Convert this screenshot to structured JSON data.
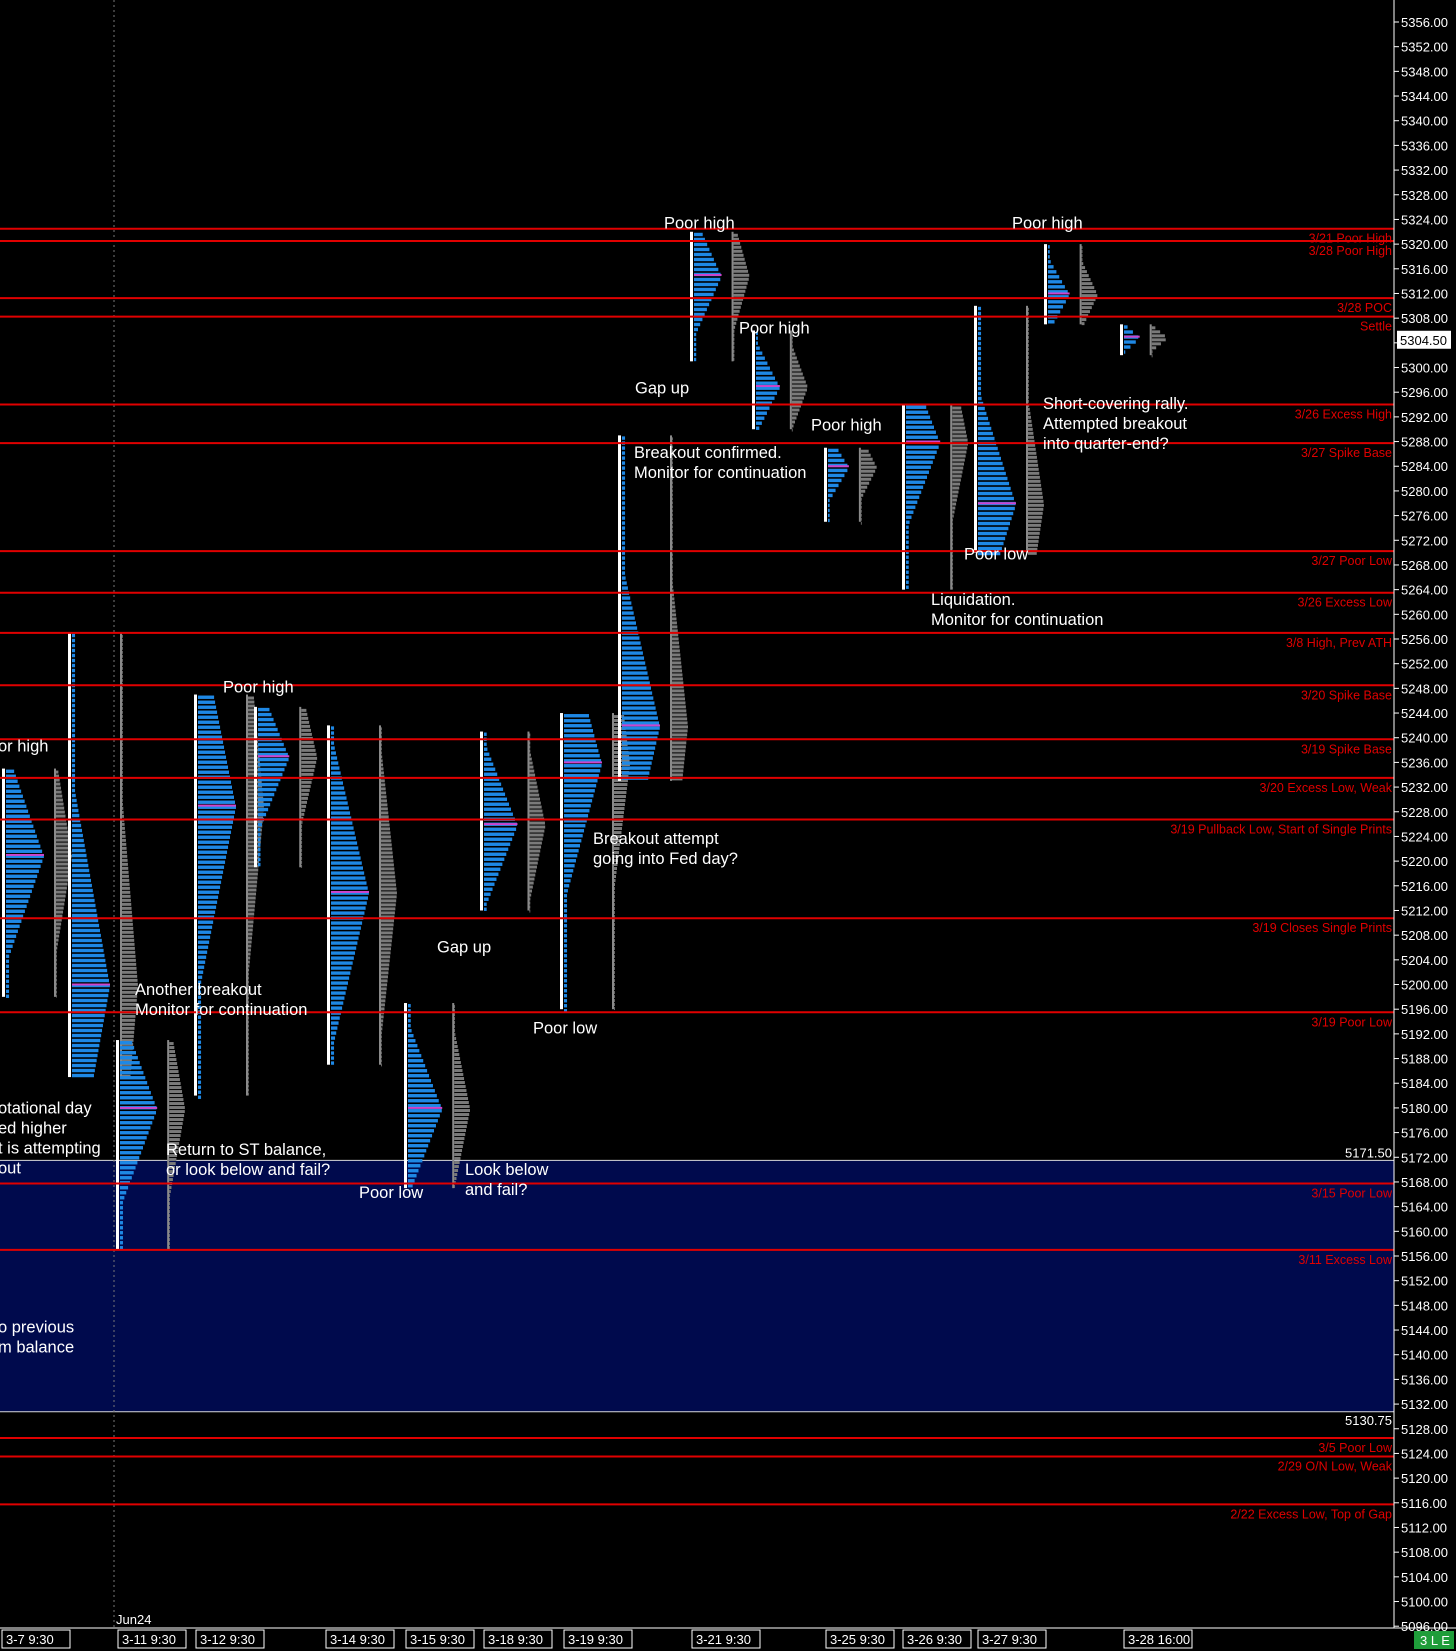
{
  "chart_data": {
    "type": "market-profile",
    "contract_label": "Jun24",
    "last_price": "5304.50",
    "status_badge": "3 L E",
    "y_range": [
      5096,
      5356
    ],
    "y_ticks": [
      "5356.00",
      "5352.00",
      "5348.00",
      "5344.00",
      "5340.00",
      "5336.00",
      "5332.00",
      "5328.00",
      "5324.00",
      "5320.00",
      "5316.00",
      "5312.00",
      "5308.00",
      "5304.00",
      "5300.00",
      "5296.00",
      "5292.00",
      "5288.00",
      "5284.00",
      "5280.00",
      "5276.00",
      "5272.00",
      "5268.00",
      "5264.00",
      "5260.00",
      "5256.00",
      "5252.00",
      "5248.00",
      "5244.00",
      "5240.00",
      "5236.00",
      "5232.00",
      "5228.00",
      "5224.00",
      "5220.00",
      "5216.00",
      "5212.00",
      "5208.00",
      "5204.00",
      "5200.00",
      "5196.00",
      "5192.00",
      "5188.00",
      "5184.00",
      "5180.00",
      "5176.00",
      "5172.00",
      "5168.00",
      "5164.00",
      "5160.00",
      "5156.00",
      "5152.00",
      "5148.00",
      "5144.00",
      "5140.00",
      "5136.00",
      "5132.00",
      "5128.00",
      "5124.00",
      "5120.00",
      "5116.00",
      "5112.00",
      "5108.00",
      "5104.00",
      "5100.00",
      "5096.00"
    ],
    "x_ticks": [
      "3-7  9:30",
      "3-11  9:30",
      "3-12  9:30",
      "3-14  9:30",
      "3-15  9:30",
      "3-18  9:30",
      "3-19  9:30",
      "3-21  9:30",
      "3-25  9:30",
      "3-26  9:30",
      "3-27  9:30",
      "3-28  16:00"
    ],
    "balance_zones": [
      {
        "high": 5171.5,
        "low": 5130.75,
        "high_label": "5171.50",
        "low_label": "5130.75"
      }
    ],
    "levels": [
      {
        "price": 5322.5,
        "label": "3/21 Poor High"
      },
      {
        "price": 5320.5,
        "label": "3/28 Poor High"
      },
      {
        "price": 5311.25,
        "label": "3/28 POC"
      },
      {
        "price": 5308.25,
        "label": "Settle"
      },
      {
        "price": 5294.0,
        "label": "3/26 Excess High"
      },
      {
        "price": 5287.75,
        "label": "3/27 Spike Base"
      },
      {
        "price": 5270.25,
        "label": "3/27 Poor Low"
      },
      {
        "price": 5263.5,
        "label": "3/26 Excess Low"
      },
      {
        "price": 5257.0,
        "label": "3/8 High, Prev ATH"
      },
      {
        "price": 5248.5,
        "label": "3/20 Spike Base"
      },
      {
        "price": 5239.75,
        "label": "3/19 Spike Base"
      },
      {
        "price": 5233.5,
        "label": "3/20 Excess Low, Weak"
      },
      {
        "price": 5226.75,
        "label": "3/19 Pullback Low, Start of Single Prints"
      },
      {
        "price": 5210.75,
        "label": "3/19 Closes Single Prints"
      },
      {
        "price": 5195.5,
        "label": "3/19 Poor Low"
      },
      {
        "price": 5167.75,
        "label": "3/15 Poor Low"
      },
      {
        "price": 5157.0,
        "label": "3/11 Excess Low"
      },
      {
        "price": 5126.5,
        "label": "3/5 Poor Low"
      },
      {
        "price": 5123.5,
        "label": "2/29 O/N Low, Weak"
      },
      {
        "price": 5115.75,
        "label": "2/22 Excess Low, Top of Gap"
      }
    ],
    "annotations": [
      {
        "lines": [
          "Poor high"
        ],
        "price": 5322.5
      },
      {
        "lines": [
          "Poor high"
        ],
        "price": 5322.5
      },
      {
        "lines": [
          "Poor high"
        ],
        "price": 5305.5
      },
      {
        "lines": [
          "Gap up"
        ],
        "price": 5295.8
      },
      {
        "lines": [
          "Poor high"
        ],
        "price": 5289.8
      },
      {
        "lines": [
          "Short-covering rally.",
          "Attempted breakout",
          "into quarter-end?"
        ],
        "price": 5293.3
      },
      {
        "lines": [
          "Breakout confirmed.",
          "Monitor for continuation"
        ],
        "price": 5285.3
      },
      {
        "lines": [
          "Poor low"
        ],
        "price": 5268.9
      },
      {
        "lines": [
          "Liquidation.",
          "Monitor for continuation"
        ],
        "price": 5261.5
      },
      {
        "lines": [
          "Poor high"
        ],
        "price": 5247.3
      },
      {
        "lines": [
          "or high"
        ],
        "price": 5237.8
      },
      {
        "lines": [
          "Breakout attempt",
          "going into Fed day?"
        ],
        "price": 5222.8
      },
      {
        "lines": [
          "Gap up"
        ],
        "price": 5205.2
      },
      {
        "lines": [
          "Another breakout",
          "Monitor for continuation"
        ],
        "price": 5198.3
      },
      {
        "lines": [
          "Poor low"
        ],
        "price": 5192.1
      },
      {
        "lines": [
          "otational day",
          "ed higher",
          "t is attempting",
          "out"
        ],
        "price": 5179.1
      },
      {
        "lines": [
          "Return to ST balance,",
          "or look below and fail?"
        ],
        "price": 5172.4
      },
      {
        "lines": [
          "Look below",
          "and fail?"
        ],
        "price": 5169.1
      },
      {
        "lines": [
          "Poor low"
        ],
        "price": 5165.4
      },
      {
        "lines": [
          "o previous",
          "m balance"
        ],
        "price": 5143.6
      }
    ],
    "profiles": [
      {
        "session": "3-7",
        "high": 5235,
        "low": 5198,
        "poc": 5221
      },
      {
        "session": "3-8",
        "high": 5257,
        "low": 5185,
        "poc": 5200
      },
      {
        "session": "3-11",
        "high": 5191,
        "low": 5157,
        "poc": 5180
      },
      {
        "session": "3-12",
        "high": 5247,
        "low": 5182,
        "poc": 5229
      },
      {
        "session": "3-13",
        "high": 5245,
        "low": 5219,
        "poc": 5237
      },
      {
        "session": "3-14",
        "high": 5242,
        "low": 5187,
        "poc": 5215
      },
      {
        "session": "3-15",
        "high": 5197,
        "low": 5167,
        "poc": 5180
      },
      {
        "session": "3-18",
        "high": 5241,
        "low": 5212,
        "poc": 5226
      },
      {
        "session": "3-19",
        "high": 5244,
        "low": 5196,
        "poc": 5236
      },
      {
        "session": "3-20",
        "high": 5289,
        "low": 5233,
        "poc": 5242
      },
      {
        "session": "3-21",
        "high": 5322,
        "low": 5301,
        "poc": 5315
      },
      {
        "session": "3-22",
        "high": 5306,
        "low": 5290,
        "poc": 5297
      },
      {
        "session": "3-25",
        "high": 5287,
        "low": 5275,
        "poc": 5284
      },
      {
        "session": "3-26",
        "high": 5294,
        "low": 5264,
        "poc": 5288
      },
      {
        "session": "3-27",
        "high": 5310,
        "low": 5270,
        "poc": 5278
      },
      {
        "session": "3-28",
        "high": 5320,
        "low": 5307,
        "poc": 5312
      },
      {
        "session": "3-28 (current)",
        "high": 5307,
        "low": 5302,
        "poc": 5305
      }
    ]
  }
}
